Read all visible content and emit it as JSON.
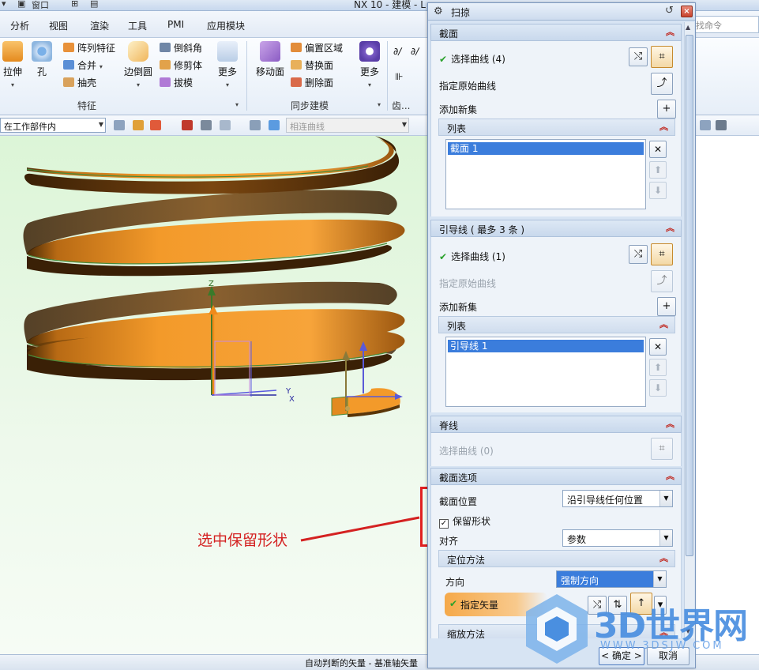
{
  "app": {
    "title": "NX 10 - 建模 - L"
  },
  "quick_access": {
    "window_label": "窗口"
  },
  "menu_tabs": [
    "分析",
    "视图",
    "渲染",
    "工具",
    "PMI",
    "应用模块"
  ],
  "search_placeholder": "找命令",
  "ribbon": {
    "big_buttons": [
      "拉伸",
      "孔",
      "边倒圆",
      "更多",
      "移动面",
      "更多"
    ],
    "feature_small": [
      "阵列特征",
      "合并",
      "抽壳"
    ],
    "edge_small": [
      "倒斜角",
      "修剪体",
      "拔模"
    ],
    "sync_small": [
      "偏置区域",
      "替换面",
      "删除面"
    ],
    "group_labels": [
      "特征",
      "同步建模",
      "齿..."
    ]
  },
  "toolbar2": {
    "scope_combo": "在工作部件内",
    "curve_rule_combo": "相连曲线"
  },
  "annotation": "选中保留形状",
  "status_text": "自动判断的矢量 - 基准轴矢量",
  "axis_labels": {
    "z": "Z",
    "y": "Y",
    "x": "X"
  },
  "dialog": {
    "title": "扫掠",
    "sections": {
      "section": {
        "title": "截面",
        "select_curve": "选择曲线 (4)",
        "specify_origin": "指定原始曲线",
        "add_new_set": "添加新集",
        "list_title": "列表",
        "list_items": [
          "截面 1"
        ]
      },
      "guides": {
        "title": "引导线 ( 最多 3 条 )",
        "select_curve": "选择曲线 (1)",
        "specify_origin": "指定原始曲线",
        "add_new_set": "添加新集",
        "list_title": "列表",
        "list_items": [
          "引导线 1"
        ]
      },
      "spine": {
        "title": "脊线",
        "select_curve": "选择曲线 (0)"
      },
      "section_options": {
        "title": "截面选项",
        "position_label": "截面位置",
        "position_value": "沿引导线任何位置",
        "preserve_shape_label": "保留形状",
        "preserve_shape_checked": true,
        "align_label": "对齐",
        "align_value": "参数",
        "orientation_title": "定位方法",
        "direction_label": "方向",
        "direction_value": "强制方向",
        "specify_vector": "指定矢量",
        "scaling_title": "缩放方法"
      }
    },
    "ok_label": "< 确定 >",
    "cancel_label": "取消"
  },
  "watermark": {
    "text": "3D世界网",
    "url": "WWW.3DSJW.COM"
  },
  "colors": {
    "spring_face": "#f0962a",
    "spring_dark": "#5a3508",
    "annotation_red": "#d42121",
    "selection_blue": "#3b7ddc",
    "check_green": "#2aa12c"
  }
}
